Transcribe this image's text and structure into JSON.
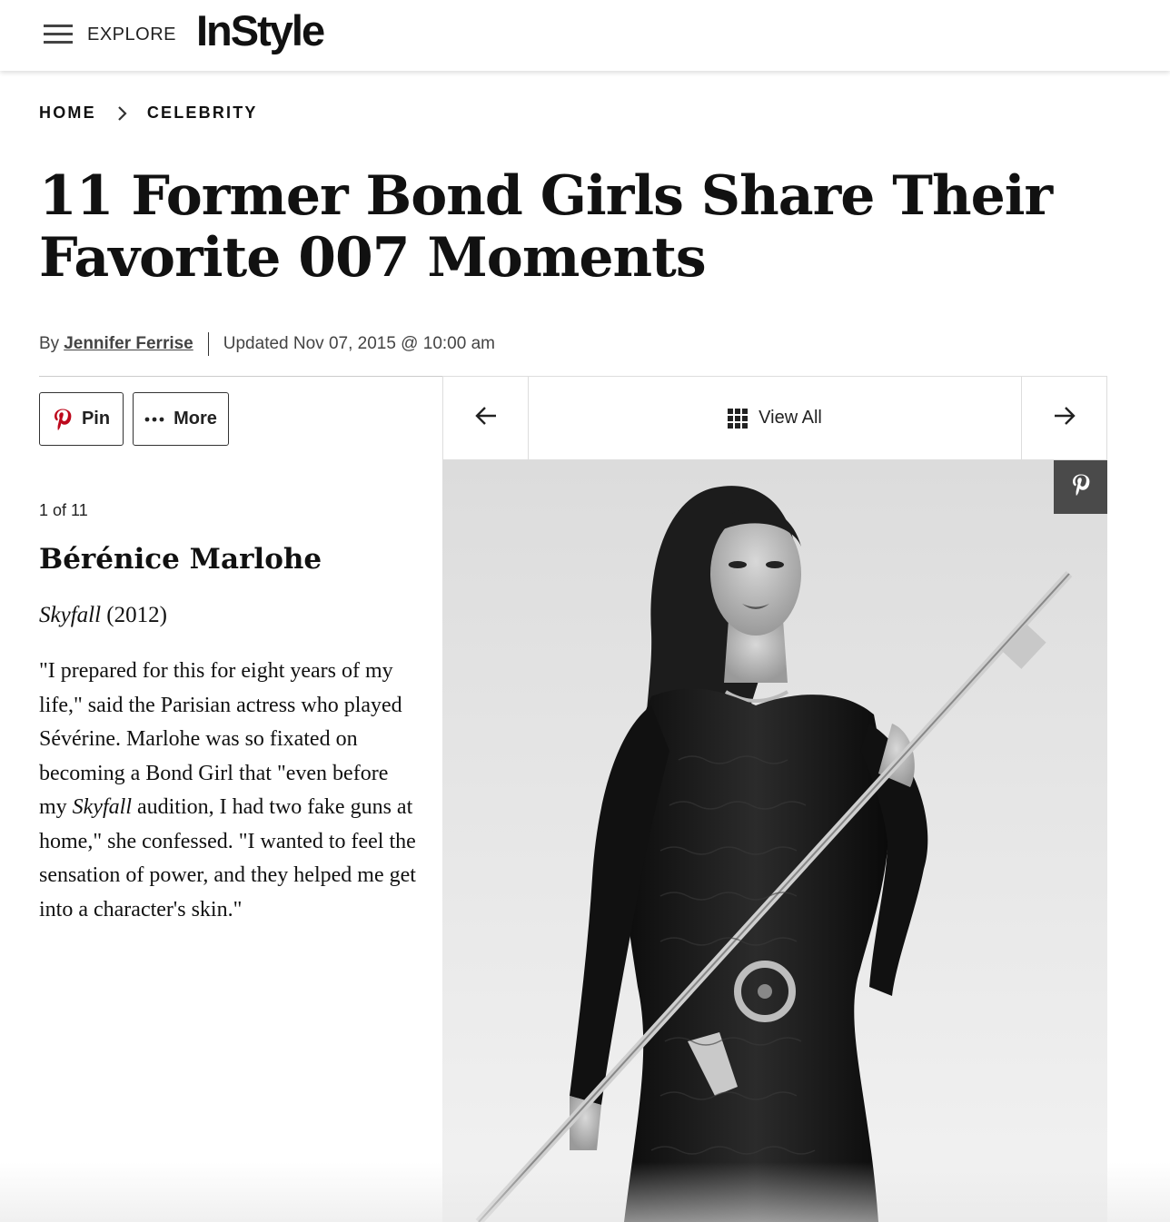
{
  "header": {
    "menu_label": "EXPLORE",
    "logo_text": "InStyle"
  },
  "breadcrumb": {
    "items": [
      "HOME",
      "CELEBRITY"
    ]
  },
  "article": {
    "title_line1": "11 Former Bond Girls Share Their",
    "title_line2": "Favorite 007 Moments",
    "byline_prefix": "By",
    "author": "Jennifer Ferrise",
    "updated": "Updated Nov 07, 2015 @ 10:00 am"
  },
  "share": {
    "pin_label": "Pin",
    "more_label": "More"
  },
  "gallery_nav": {
    "view_all_label": "View All"
  },
  "slide": {
    "counter": "1 of 11",
    "name": "Bérénice Marlohe",
    "film_title": "Skyfall",
    "film_year": "(2012)",
    "body_part1": "\"I prepared for this for eight years of my life,\" said the Parisian actress who played Sévérine. Marlohe was so fixated on becoming a Bond Girl that \"even before my ",
    "body_italic": "Skyfall",
    "body_part2": " audition, I had two fake guns at home,\" she confessed. \"I wanted to feel the sensation of power, and they helped me get into a character's skin.\""
  },
  "colors": {
    "pinterest_red": "#BD081C",
    "pin_overlay_bg": "#4A4A4A",
    "text": "#111111"
  },
  "icons": [
    "hamburger-icon",
    "chevron-right-icon",
    "pinterest-icon",
    "more-dots-icon",
    "arrow-left-icon",
    "grid-icon",
    "arrow-right-icon"
  ]
}
